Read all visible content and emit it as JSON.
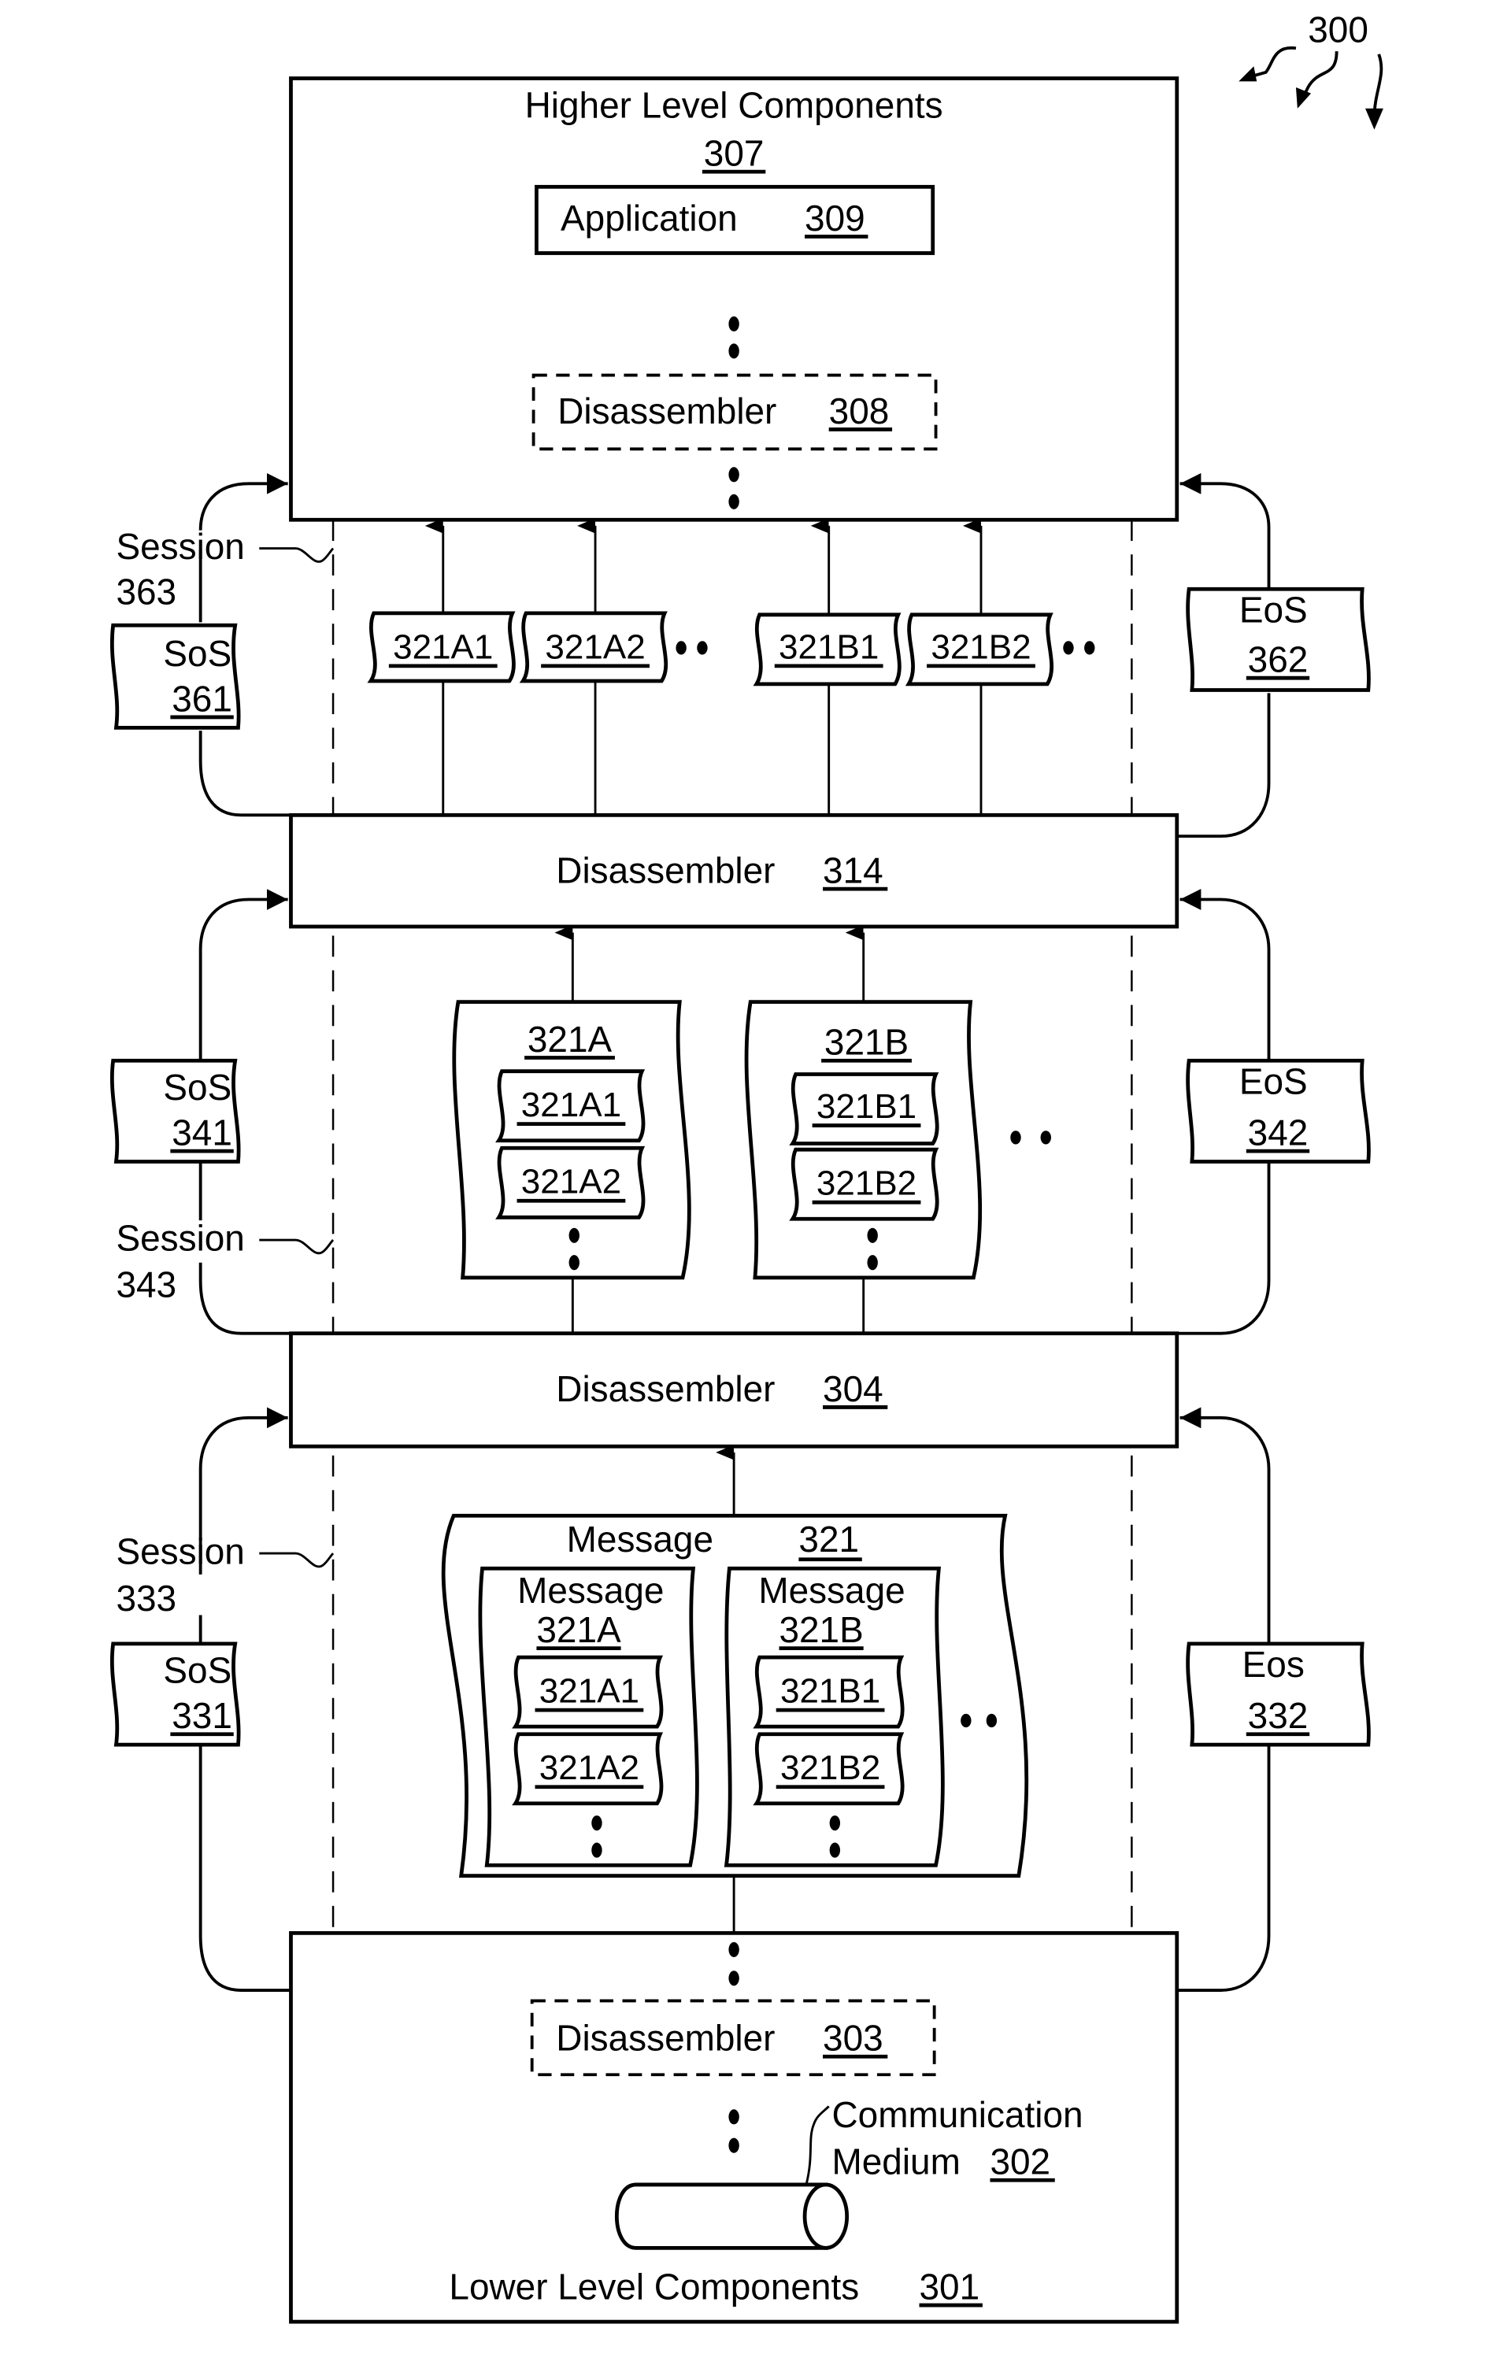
{
  "figure": {
    "ref": "300",
    "higher": {
      "title": "Higher Level Components",
      "ref": "307"
    },
    "application": {
      "label": "Application",
      "ref": "309"
    },
    "disassembler_308": {
      "label": "Disassembler",
      "ref": "308"
    },
    "disassembler_314": {
      "label": "Disassembler",
      "ref": "314"
    },
    "disassembler_304": {
      "label": "Disassembler",
      "ref": "304"
    },
    "disassembler_303": {
      "label": "Disassembler",
      "ref": "303"
    },
    "lower": {
      "title": "Lower Level Components",
      "ref": "301"
    },
    "medium": {
      "line1": "Communication",
      "line2": "Medium",
      "ref": "302"
    },
    "session_363": {
      "label": "Session",
      "ref": "363"
    },
    "session_343": {
      "label": "Session",
      "ref": "343"
    },
    "session_333": {
      "label": "Session",
      "ref": "333"
    },
    "sos_361": {
      "label": "SoS",
      "ref": "361"
    },
    "eos_362": {
      "label": "EoS",
      "ref": "362"
    },
    "sos_341": {
      "label": "SoS",
      "ref": "341"
    },
    "eos_342": {
      "label": "EoS",
      "ref": "342"
    },
    "sos_331": {
      "label": "SoS",
      "ref": "331"
    },
    "eos_332": {
      "label": "Eos",
      "ref": "332"
    },
    "top_fragments": [
      "321A1",
      "321A2",
      "321B1",
      "321B2"
    ],
    "mid_messages": [
      {
        "ref": "321A",
        "parts": [
          "321A1",
          "321A2"
        ]
      },
      {
        "ref": "321B",
        "parts": [
          "321B1",
          "321B2"
        ]
      }
    ],
    "message_321": {
      "label": "Message",
      "ref": "321",
      "subs": [
        {
          "label": "Message",
          "ref": "321A",
          "parts": [
            "321A1",
            "321A2"
          ]
        },
        {
          "label": "Message",
          "ref": "321B",
          "parts": [
            "321B1",
            "321B2"
          ]
        }
      ]
    }
  }
}
